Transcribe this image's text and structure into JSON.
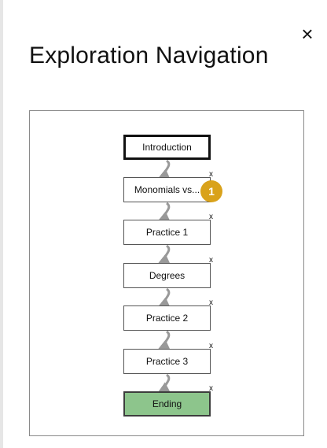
{
  "header": {
    "title": "Exploration Navigation",
    "close_symbol": "×"
  },
  "graph": {
    "nodes": [
      {
        "label": "Introduction",
        "type": "start"
      },
      {
        "label": "Monomials vs...",
        "type": "normal"
      },
      {
        "label": "Practice 1",
        "type": "normal"
      },
      {
        "label": "Degrees",
        "type": "normal"
      },
      {
        "label": "Practice 2",
        "type": "normal"
      },
      {
        "label": "Practice 3",
        "type": "normal"
      },
      {
        "label": "Ending",
        "type": "end"
      }
    ],
    "delete_symbol": "x",
    "badge": "1"
  },
  "colors": {
    "end_node": "#8dc58c",
    "badge": "#d9a21b",
    "arrow": "#999999"
  },
  "icons": {
    "close": "close-icon",
    "delete": "delete-node-icon"
  }
}
